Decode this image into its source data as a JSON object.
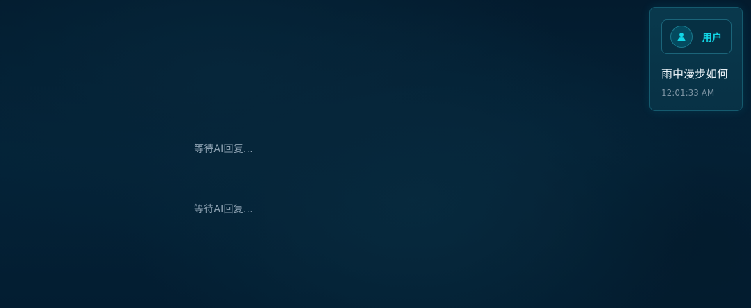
{
  "chat": {
    "ai_placeholders": [
      "等待AI回复...",
      "等待AI回复..."
    ],
    "user_message": {
      "sender_label": "用户",
      "avatar_icon": "user-icon",
      "text": "雨中漫步如何",
      "timestamp": "12:01:33 AM"
    }
  },
  "colors": {
    "accent": "#12d6e6",
    "background": "#042338",
    "card_border": "#155a6e"
  }
}
